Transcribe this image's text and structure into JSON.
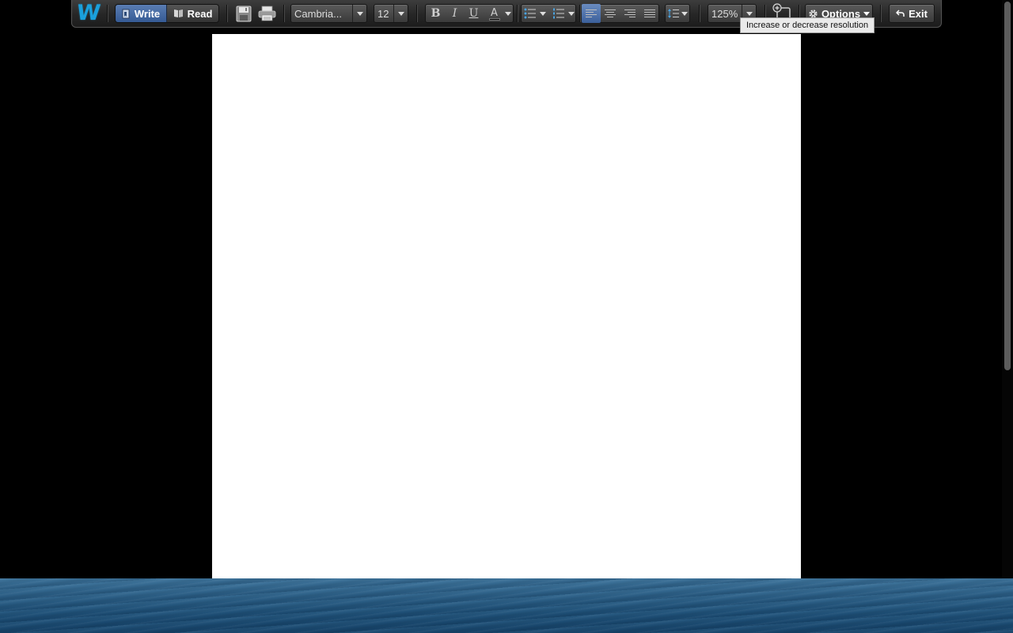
{
  "toolbar": {
    "logo_letter": "W",
    "mode": {
      "write_label": "Write",
      "read_label": "Read",
      "active": "write"
    },
    "file": {
      "save_icon": "save-icon",
      "print_icon": "print-icon"
    },
    "font": {
      "family": "Cambria...",
      "size": "12"
    },
    "format": {
      "bold": "B",
      "italic": "I",
      "underline": "U",
      "text_color_letter": "A",
      "text_color": "#000000"
    },
    "paragraph": {
      "bullets_icon": "bulleted-list-icon",
      "numbering_icon": "numbered-list-icon",
      "active_alignment": "left",
      "line_spacing_icon": "line-spacing-icon"
    },
    "zoom": "125%",
    "options_label": "Options",
    "exit_label": "Exit"
  },
  "tooltip": "Increase or decrease resolution",
  "colors": {
    "accent": "#1aa0dc",
    "active_button": "#4a6ea8",
    "ocean": "#2a5c84"
  }
}
